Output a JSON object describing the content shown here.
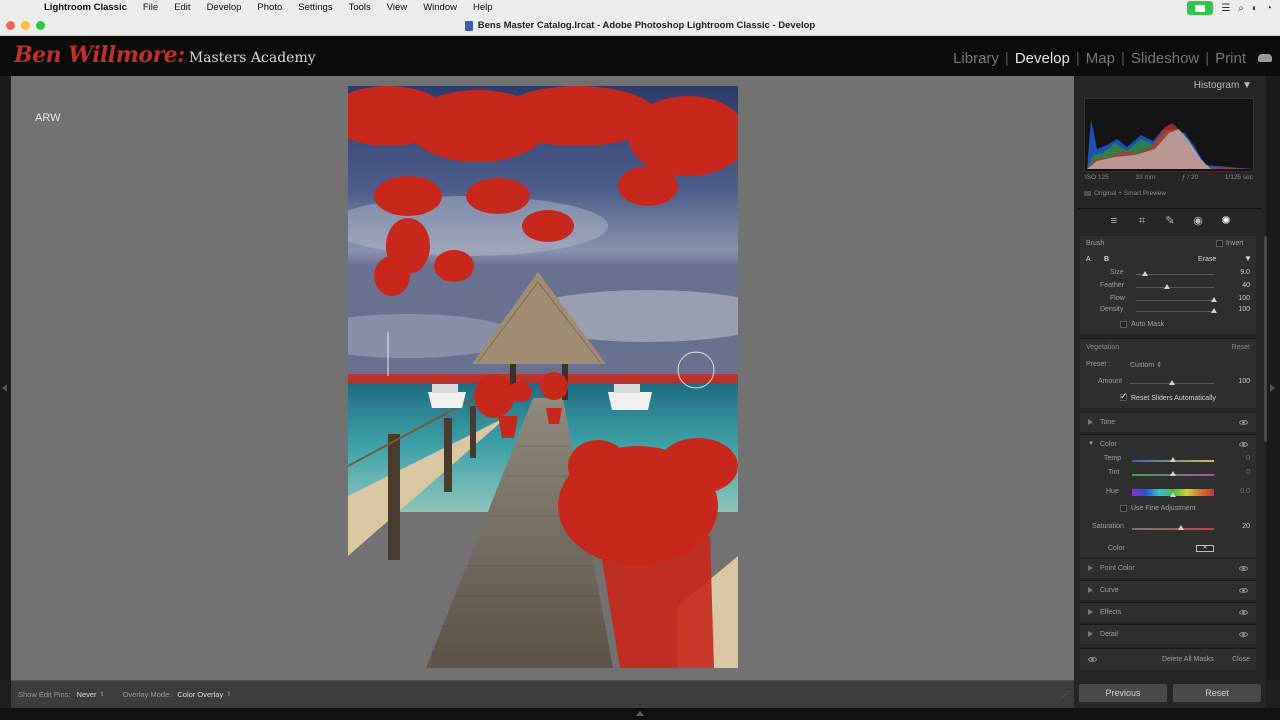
{
  "menubar": {
    "app_name": "Lightroom Classic",
    "items": [
      "File",
      "Edit",
      "Develop",
      "Photo",
      "Settings",
      "Tools",
      "View",
      "Window",
      "Help"
    ]
  },
  "window": {
    "title": "Bens Master Catalog.lrcat - Adobe Photoshop Lightroom Classic - Develop"
  },
  "identity_plate": {
    "script": "Ben Willmore:",
    "name": "Masters Academy"
  },
  "modules": {
    "library": "Library",
    "develop": "Develop",
    "map": "Map",
    "slideshow": "Slideshow",
    "print": "Print",
    "active": "Develop"
  },
  "viewer": {
    "format_label": "ARW"
  },
  "toolbar": {
    "show_pins_label": "Show Edit Pins:",
    "show_pins_value": "Never",
    "overlay_label": "Overlay Mode:",
    "overlay_value": "Color Overlay"
  },
  "histogram": {
    "title": "Histogram",
    "iso": "ISO 125",
    "focal": "33 mm",
    "aperture": "ƒ / 20",
    "shutter": "1/125 sec",
    "preview_label": "Original + Smart Preview"
  },
  "brush": {
    "title": "Brush",
    "invert_label": "Invert",
    "a_label": "A",
    "b_label": "B",
    "erase_label": "Erase",
    "size_label": "Size",
    "size_value": "9.0",
    "size_level": 0.12,
    "feather_label": "Feather",
    "feather_value": "40",
    "feather_level": 0.4,
    "flow_label": "Flow",
    "flow_value": "100",
    "flow_level": 1.0,
    "density_label": "Density",
    "density_value": "100",
    "density_level": 1.0,
    "automask_label": "Auto Mask"
  },
  "mask": {
    "name": "Vegetation",
    "reset_label": "Reset",
    "preset_label": "Preset :",
    "preset_value": "Custom",
    "amount_label": "Amount",
    "amount_value": "100",
    "amount_level": 0.5,
    "reset_sliders_label": "Reset Sliders Automatically"
  },
  "tone": {
    "label": "Tone"
  },
  "color": {
    "label": "Color",
    "temp_label": "Temp",
    "temp_value": "0",
    "temp_level": 0.5,
    "tint_label": "Tint",
    "tint_value": "0",
    "tint_level": 0.5,
    "hue_label": "Hue",
    "hue_value": "0.0",
    "hue_level": 0.5,
    "fine_label": "Use Fine Adjustment",
    "sat_label": "Saturation",
    "sat_value": "20",
    "sat_level": 0.6,
    "color_label": "Color"
  },
  "sections": {
    "point_color": "Point Color",
    "curve": "Curve",
    "effects": "Effects",
    "detail": "Detail"
  },
  "footer_actions": {
    "delete_all": "Delete All Masks",
    "close": "Close"
  },
  "buttons": {
    "previous": "Previous",
    "reset": "Reset"
  },
  "colors": {
    "brand_red": "#c0302a",
    "mask_overlay": "#c8281c",
    "panel_bg": "#2f2f2f"
  }
}
